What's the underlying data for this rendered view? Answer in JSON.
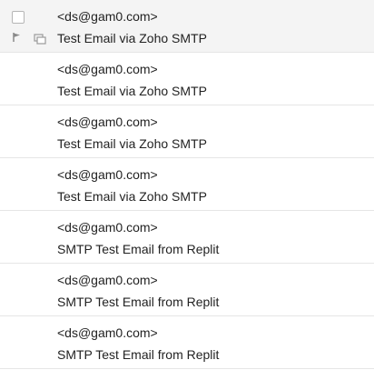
{
  "emails": [
    {
      "sender": "<ds@gam0.com>",
      "subject": "Test Email via Zoho SMTP"
    },
    {
      "sender": "<ds@gam0.com>",
      "subject": "Test Email via Zoho SMTP"
    },
    {
      "sender": "<ds@gam0.com>",
      "subject": "Test Email via Zoho SMTP"
    },
    {
      "sender": "<ds@gam0.com>",
      "subject": "Test Email via Zoho SMTP"
    },
    {
      "sender": "<ds@gam0.com>",
      "subject": "SMTP Test Email from Replit"
    },
    {
      "sender": "<ds@gam0.com>",
      "subject": "SMTP Test Email from Replit"
    },
    {
      "sender": "<ds@gam0.com>",
      "subject": "SMTP Test Email from Replit"
    }
  ],
  "icons": {
    "select": "checkbox-icon",
    "flag": "flag-icon",
    "thread": "conversation-icon"
  }
}
